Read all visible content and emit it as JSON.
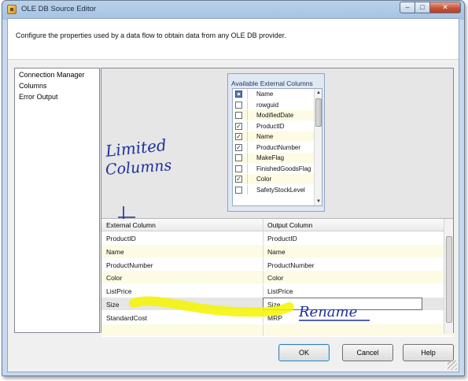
{
  "window": {
    "title": "OLE DB Source Editor",
    "close_glyph": "✕",
    "maximize_glyph": "□",
    "minimize_glyph": "–"
  },
  "header": {
    "description": "Configure the properties used by a data flow to obtain data from any OLE DB provider."
  },
  "nav": {
    "items": [
      {
        "label": "Connection Manager"
      },
      {
        "label": "Columns"
      },
      {
        "label": "Error Output"
      }
    ]
  },
  "available_columns": {
    "title": "Available External Columns",
    "header": "Name",
    "rows": [
      {
        "name": "rowguid",
        "checked": false
      },
      {
        "name": "ModifiedDate",
        "checked": false
      },
      {
        "name": "ProductID",
        "checked": true
      },
      {
        "name": "Name",
        "checked": true
      },
      {
        "name": "ProductNumber",
        "checked": true
      },
      {
        "name": "MakeFlag",
        "checked": false
      },
      {
        "name": "FinishedGoodsFlag",
        "checked": false
      },
      {
        "name": "Color",
        "checked": true
      },
      {
        "name": "SafetyStockLevel",
        "checked": false
      }
    ]
  },
  "mapping": {
    "col1_header": "External Column",
    "col2_header": "Output Column",
    "rows": [
      {
        "external": "ProductID",
        "output": "ProductID"
      },
      {
        "external": "Name",
        "output": "Name"
      },
      {
        "external": "ProductNumber",
        "output": "ProductNumber"
      },
      {
        "external": "Color",
        "output": "Color"
      },
      {
        "external": "ListPrice",
        "output": "ListPrice"
      },
      {
        "external": "Size",
        "output": "Size"
      },
      {
        "external": "StandardCost",
        "output": "MRP"
      }
    ]
  },
  "annotations": {
    "limited_line1": "Limited",
    "limited_line2": "Columns",
    "rename": "Rename",
    "ink_color": "#1d2f9c",
    "highlight_color": "#f5f500"
  },
  "buttons": {
    "ok": "OK",
    "cancel": "Cancel",
    "help": "Help"
  }
}
